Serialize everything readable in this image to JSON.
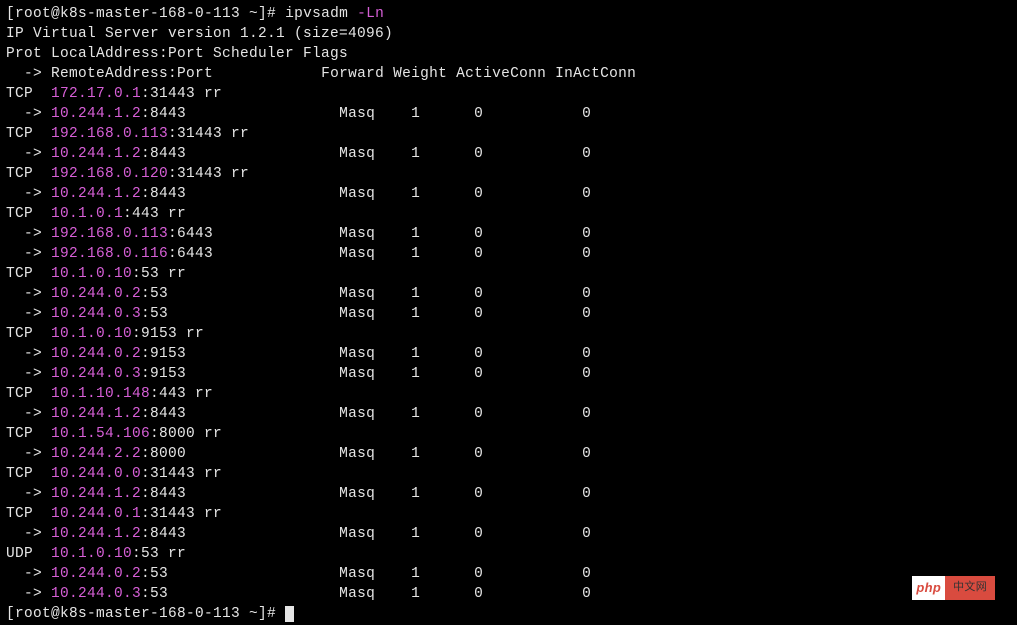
{
  "prompt": {
    "host": "[root@k8s-master-168-0-113 ~]#",
    "command": "ipvsadm",
    "flag": "-Ln"
  },
  "version_line": "IP Virtual Server version 1.2.1 (size=4096)",
  "header1": "Prot LocalAddress:Port Scheduler Flags",
  "header2": {
    "arrow": "  ->",
    "remote": "RemoteAddress:Port",
    "cols": "Forward Weight ActiveConn InActConn"
  },
  "services": [
    {
      "prot": "TCP",
      "ip": "172.17.0.1",
      "port": ":31443 rr",
      "backends": [
        {
          "ip": "10.244.1.2",
          "port": ":8443",
          "fwd": "Masq",
          "w": "1",
          "ac": "0",
          "ic": "0"
        }
      ]
    },
    {
      "prot": "TCP",
      "ip": "192.168.0.113",
      "port": ":31443 rr",
      "backends": [
        {
          "ip": "10.244.1.2",
          "port": ":8443",
          "fwd": "Masq",
          "w": "1",
          "ac": "0",
          "ic": "0"
        }
      ]
    },
    {
      "prot": "TCP",
      "ip": "192.168.0.120",
      "port": ":31443 rr",
      "backends": [
        {
          "ip": "10.244.1.2",
          "port": ":8443",
          "fwd": "Masq",
          "w": "1",
          "ac": "0",
          "ic": "0"
        }
      ]
    },
    {
      "prot": "TCP",
      "ip": "10.1.0.1",
      "port": ":443 rr",
      "backends": [
        {
          "ip": "192.168.0.113",
          "port": ":6443",
          "fwd": "Masq",
          "w": "1",
          "ac": "0",
          "ic": "0"
        },
        {
          "ip": "192.168.0.116",
          "port": ":6443",
          "fwd": "Masq",
          "w": "1",
          "ac": "0",
          "ic": "0"
        }
      ]
    },
    {
      "prot": "TCP",
      "ip": "10.1.0.10",
      "port": ":53 rr",
      "backends": [
        {
          "ip": "10.244.0.2",
          "port": ":53",
          "fwd": "Masq",
          "w": "1",
          "ac": "0",
          "ic": "0"
        },
        {
          "ip": "10.244.0.3",
          "port": ":53",
          "fwd": "Masq",
          "w": "1",
          "ac": "0",
          "ic": "0"
        }
      ]
    },
    {
      "prot": "TCP",
      "ip": "10.1.0.10",
      "port": ":9153 rr",
      "backends": [
        {
          "ip": "10.244.0.2",
          "port": ":9153",
          "fwd": "Masq",
          "w": "1",
          "ac": "0",
          "ic": "0"
        },
        {
          "ip": "10.244.0.3",
          "port": ":9153",
          "fwd": "Masq",
          "w": "1",
          "ac": "0",
          "ic": "0"
        }
      ]
    },
    {
      "prot": "TCP",
      "ip": "10.1.10.148",
      "port": ":443 rr",
      "backends": [
        {
          "ip": "10.244.1.2",
          "port": ":8443",
          "fwd": "Masq",
          "w": "1",
          "ac": "0",
          "ic": "0"
        }
      ]
    },
    {
      "prot": "TCP",
      "ip": "10.1.54.106",
      "port": ":8000 rr",
      "backends": [
        {
          "ip": "10.244.2.2",
          "port": ":8000",
          "fwd": "Masq",
          "w": "1",
          "ac": "0",
          "ic": "0"
        }
      ]
    },
    {
      "prot": "TCP",
      "ip": "10.244.0.0",
      "port": ":31443 rr",
      "backends": [
        {
          "ip": "10.244.1.2",
          "port": ":8443",
          "fwd": "Masq",
          "w": "1",
          "ac": "0",
          "ic": "0"
        }
      ]
    },
    {
      "prot": "TCP",
      "ip": "10.244.0.1",
      "port": ":31443 rr",
      "backends": [
        {
          "ip": "10.244.1.2",
          "port": ":8443",
          "fwd": "Masq",
          "w": "1",
          "ac": "0",
          "ic": "0"
        }
      ]
    },
    {
      "prot": "UDP",
      "ip": "10.1.0.10",
      "port": ":53 rr",
      "backends": [
        {
          "ip": "10.244.0.2",
          "port": ":53",
          "fwd": "Masq",
          "w": "1",
          "ac": "0",
          "ic": "0"
        },
        {
          "ip": "10.244.0.3",
          "port": ":53",
          "fwd": "Masq",
          "w": "1",
          "ac": "0",
          "ic": "0"
        }
      ]
    }
  ],
  "prompt2": "[root@k8s-master-168-0-113 ~]#",
  "badge": {
    "left": "php",
    "right": "中文网"
  }
}
